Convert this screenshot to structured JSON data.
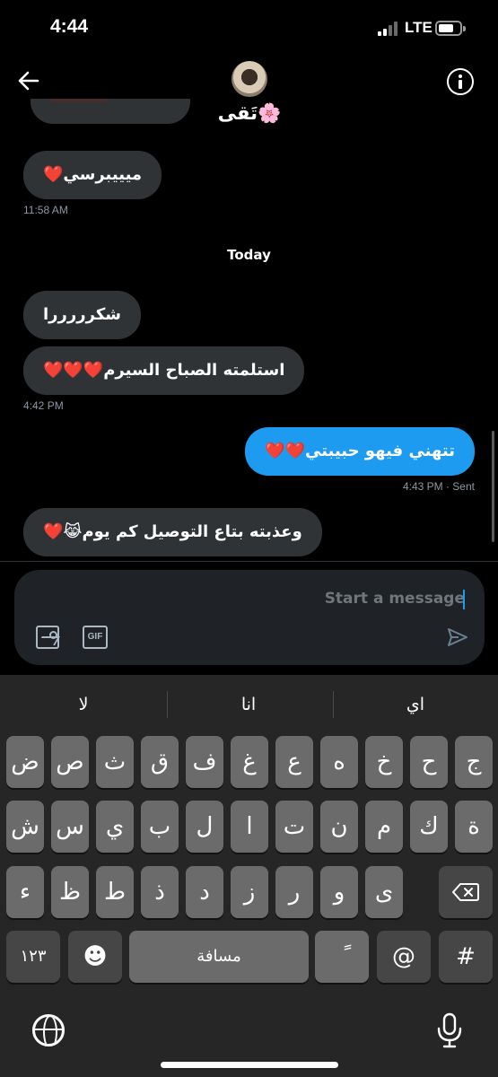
{
  "status_bar": {
    "time": "4:44",
    "network": "LTE"
  },
  "header": {
    "contact_name": "تَقى🌸"
  },
  "messages": [
    {
      "text": "ميييبرسي❤️",
      "direction": "in"
    },
    {
      "text": "شكرررررا",
      "direction": "in"
    },
    {
      "text": "استلمته الصباح السيرم❤️❤️❤️",
      "direction": "in"
    },
    {
      "text": "تتهني فيهو حبيبتي❤️❤️",
      "direction": "out"
    },
    {
      "text": "وعذبته بتاع التوصيل كم يوم😹❤️",
      "direction": "in"
    }
  ],
  "timestamps": {
    "t1": "11:58 AM",
    "t2": "4:42 PM",
    "t3": "4:43 PM · Sent"
  },
  "day_separator": "Today",
  "composer": {
    "placeholder": "Start a message",
    "gif_label": "GIF"
  },
  "keyboard": {
    "suggestions": [
      "لا",
      "انا",
      "اي"
    ],
    "row1": [
      "ض",
      "ص",
      "ث",
      "ق",
      "ف",
      "غ",
      "ع",
      "ه",
      "خ",
      "ح",
      "ج"
    ],
    "row2": [
      "ش",
      "س",
      "ي",
      "ب",
      "ل",
      "ا",
      "ت",
      "ن",
      "م",
      "ك",
      "ة"
    ],
    "row3": [
      "ء",
      "ظ",
      "ط",
      "ذ",
      "د",
      "ز",
      "ر",
      "و",
      "ى"
    ],
    "numbers_key": "١٢٣",
    "emoji_key": "☻",
    "space_key": "مسافة",
    "diacritic_key": "ً",
    "at_key": "@",
    "hash_key": "#"
  },
  "colors": {
    "outgoing": "#1d9bf0",
    "incoming": "#2f3336",
    "keyboard": "#262626"
  },
  "icons": [
    "back-arrow-icon",
    "info-icon",
    "image-icon",
    "gif-icon",
    "send-icon",
    "backspace-icon",
    "globe-icon",
    "mic-icon"
  ]
}
